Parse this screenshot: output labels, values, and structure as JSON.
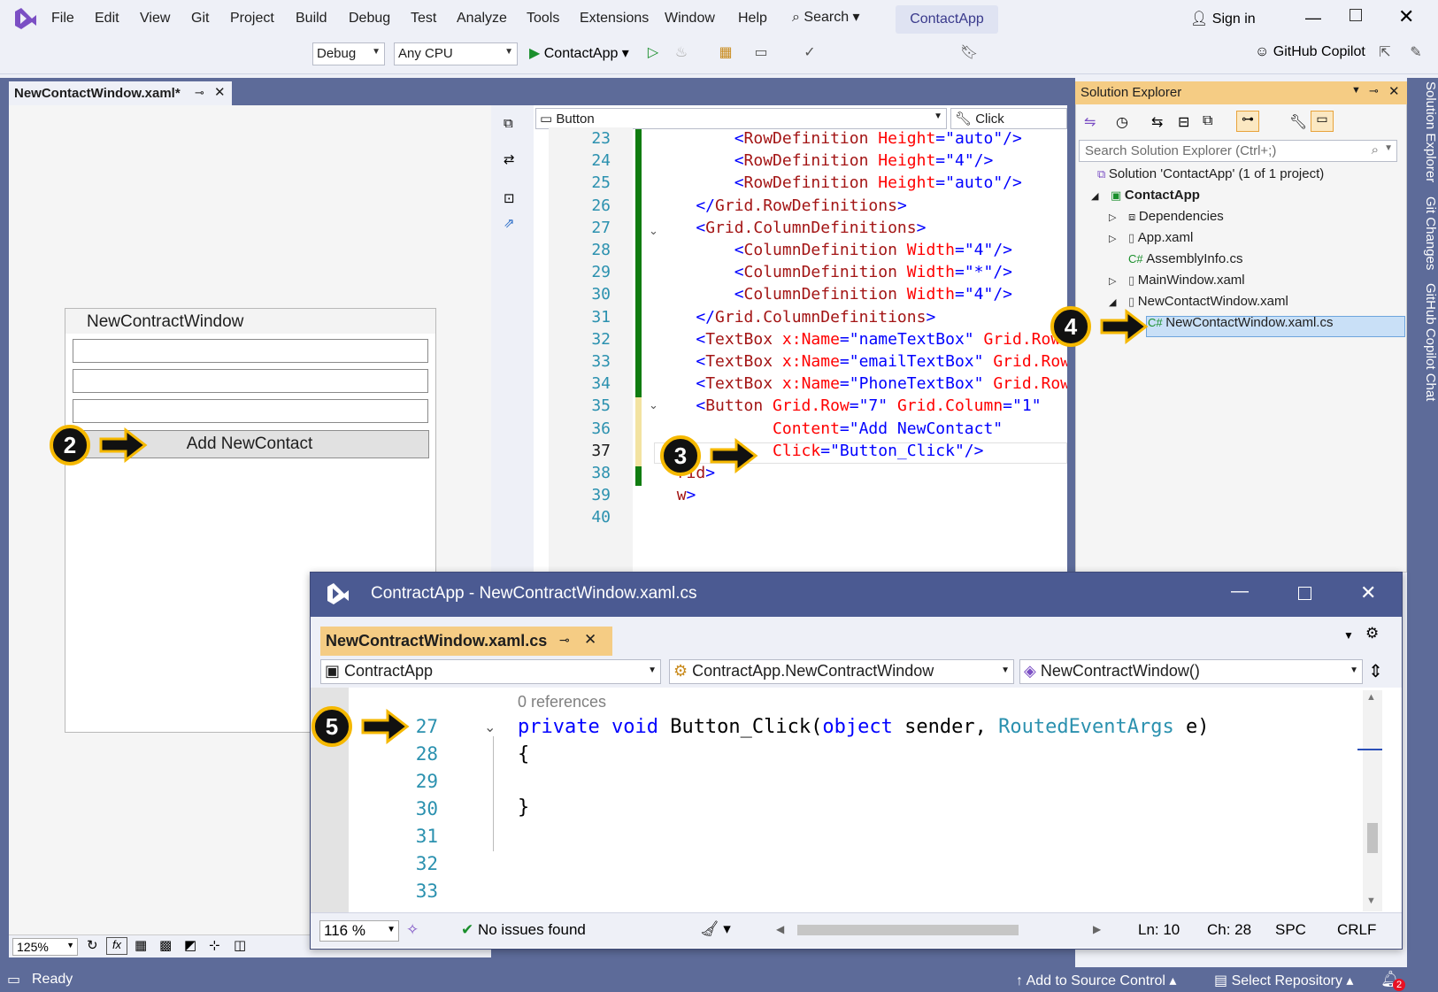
{
  "menu": {
    "items": [
      "File",
      "Edit",
      "View",
      "Git",
      "Project",
      "Build",
      "Debug",
      "Test",
      "Analyze",
      "Tools",
      "Extensions",
      "Window",
      "Help"
    ],
    "search_label": "Search",
    "app_name": "ContactApp",
    "sign_in": "Sign in"
  },
  "toolbar": {
    "config": "Debug",
    "platform": "Any CPU",
    "run_target": "ContactApp",
    "copilot": "GitHub Copilot"
  },
  "designer": {
    "tab_label": "NewContactWindow.xaml*",
    "window_title": "NewContractWindow",
    "button_label": "Add NewContact",
    "zoom": "125%",
    "fx_label": "fx"
  },
  "editor": {
    "element_combo": "Button",
    "event_combo": "Click",
    "lines": [
      {
        "n": "23",
        "segments": [
          [
            "punc",
            "        <"
          ],
          [
            "tag",
            "RowDefinition "
          ],
          [
            "attr",
            "Height"
          ],
          [
            "punc",
            "="
          ],
          [
            "val",
            "\"auto\""
          ],
          [
            "punc",
            "/>"
          ]
        ]
      },
      {
        "n": "24",
        "segments": [
          [
            "punc",
            "        <"
          ],
          [
            "tag",
            "RowDefinition "
          ],
          [
            "attr",
            "Height"
          ],
          [
            "punc",
            "="
          ],
          [
            "val",
            "\"4\""
          ],
          [
            "punc",
            "/>"
          ]
        ]
      },
      {
        "n": "25",
        "segments": [
          [
            "punc",
            "        <"
          ],
          [
            "tag",
            "RowDefinition "
          ],
          [
            "attr",
            "Height"
          ],
          [
            "punc",
            "="
          ],
          [
            "val",
            "\"auto\""
          ],
          [
            "punc",
            "/>"
          ]
        ]
      },
      {
        "n": "26",
        "segments": [
          [
            "punc",
            "    </"
          ],
          [
            "tag",
            "Grid.RowDefinitions"
          ],
          [
            "punc",
            ">"
          ]
        ]
      },
      {
        "n": "27",
        "segments": [
          [
            "punc",
            "    <"
          ],
          [
            "tag",
            "Grid.ColumnDefinitions"
          ],
          [
            "punc",
            ">"
          ]
        ]
      },
      {
        "n": "28",
        "segments": [
          [
            "punc",
            "        <"
          ],
          [
            "tag",
            "ColumnDefinition "
          ],
          [
            "attr",
            "Width"
          ],
          [
            "punc",
            "="
          ],
          [
            "val",
            "\"4\""
          ],
          [
            "punc",
            "/>"
          ]
        ]
      },
      {
        "n": "29",
        "segments": [
          [
            "punc",
            "        <"
          ],
          [
            "tag",
            "ColumnDefinition "
          ],
          [
            "attr",
            "Width"
          ],
          [
            "punc",
            "="
          ],
          [
            "val",
            "\"*\""
          ],
          [
            "punc",
            "/>"
          ]
        ]
      },
      {
        "n": "30",
        "segments": [
          [
            "punc",
            "        <"
          ],
          [
            "tag",
            "ColumnDefinition "
          ],
          [
            "attr",
            "Width"
          ],
          [
            "punc",
            "="
          ],
          [
            "val",
            "\"4\""
          ],
          [
            "punc",
            "/>"
          ]
        ]
      },
      {
        "n": "31",
        "segments": [
          [
            "punc",
            "    </"
          ],
          [
            "tag",
            "Grid.ColumnDefinitions"
          ],
          [
            "punc",
            ">"
          ]
        ]
      },
      {
        "n": "32",
        "segments": [
          [
            "punc",
            "    <"
          ],
          [
            "tag",
            "TextBox "
          ],
          [
            "attr",
            "x:Name"
          ],
          [
            "punc",
            "="
          ],
          [
            "val",
            "\"nameTextBox\" "
          ],
          [
            "attr",
            "Grid.Row"
          ]
        ]
      },
      {
        "n": "33",
        "segments": [
          [
            "punc",
            "    <"
          ],
          [
            "tag",
            "TextBox "
          ],
          [
            "attr",
            "x:Name"
          ],
          [
            "punc",
            "="
          ],
          [
            "val",
            "\"emailTextBox\" "
          ],
          [
            "attr",
            "Grid.Row"
          ]
        ]
      },
      {
        "n": "34",
        "segments": [
          [
            "punc",
            "    <"
          ],
          [
            "tag",
            "TextBox "
          ],
          [
            "attr",
            "x:Name"
          ],
          [
            "punc",
            "="
          ],
          [
            "val",
            "\"PhoneTextBox\" "
          ],
          [
            "attr",
            "Grid.Row"
          ]
        ]
      },
      {
        "n": "35",
        "segments": [
          [
            "punc",
            "    <"
          ],
          [
            "tag",
            "Button "
          ],
          [
            "attr",
            "Grid.Row"
          ],
          [
            "punc",
            "="
          ],
          [
            "val",
            "\"7\" "
          ],
          [
            "attr",
            "Grid.Column"
          ],
          [
            "punc",
            "="
          ],
          [
            "val",
            "\"1\""
          ]
        ]
      },
      {
        "n": "36",
        "segments": [
          [
            "attr",
            "            Content"
          ],
          [
            "punc",
            "="
          ],
          [
            "val",
            "\"Add NewContact\""
          ]
        ]
      },
      {
        "n": "37",
        "segments": [
          [
            "attr",
            "            Click"
          ],
          [
            "punc",
            "="
          ],
          [
            "val",
            "\"Button_Click\""
          ],
          [
            "punc",
            "/>"
          ]
        ]
      },
      {
        "n": "38",
        "segments": [
          [
            "punc",
            "  "
          ],
          [
            "tag",
            "rid"
          ],
          [
            "punc",
            ">"
          ]
        ]
      },
      {
        "n": "39",
        "segments": [
          [
            "punc",
            "  "
          ],
          [
            "tag",
            "w"
          ],
          [
            "punc",
            ">"
          ]
        ]
      },
      {
        "n": "40",
        "segments": []
      }
    ]
  },
  "solution_explorer": {
    "title": "Solution Explorer",
    "search_placeholder": "Search Solution Explorer (Ctrl+;)",
    "items": [
      {
        "label": "Solution 'ContactApp' (1 of 1 project)"
      },
      {
        "label": "ContactApp"
      },
      {
        "label": "Dependencies"
      },
      {
        "label": "App.xaml"
      },
      {
        "label": "AssemblyInfo.cs"
      },
      {
        "label": "MainWindow.xaml"
      },
      {
        "label": "NewContactWindow.xaml"
      },
      {
        "label": "NewContactWindow.xaml.cs"
      }
    ]
  },
  "side_tabs": [
    "Solution Explorer",
    "Git Changes",
    "GitHub Copilot Chat"
  ],
  "floating": {
    "title": "ContractApp - NewContractWindow.xaml.cs",
    "tab_label": "NewContractWindow.xaml.cs",
    "combo_project": "ContractApp",
    "combo_class": "ContractApp.NewContractWindow",
    "combo_member": "NewContractWindow()",
    "references": "0 references",
    "line_numbers": [
      "27",
      "28",
      "29",
      "30",
      "31",
      "32",
      "33"
    ],
    "code_line_27": {
      "k1": "private",
      "k2": "void",
      "name": " Button_Click(",
      "k3": "object",
      "mid": " sender, ",
      "type": "RoutedEventArgs",
      "end": " e)"
    },
    "brace_open": "{",
    "brace_close": "}",
    "zoom": "116 %",
    "issues": "No issues found",
    "ln": "Ln: 10",
    "ch": "Ch: 28",
    "spc": "SPC",
    "crlf": "CRLF"
  },
  "callouts": [
    "2",
    "3",
    "4",
    "5"
  ],
  "status": {
    "ready": "Ready",
    "source_control": "Add to Source Control",
    "repository": "Select Repository",
    "notifications": "2"
  },
  "colors": {
    "accent": "#5d6b99",
    "tab_active": "#f5cc84",
    "callout_ring": "#f5b800"
  }
}
